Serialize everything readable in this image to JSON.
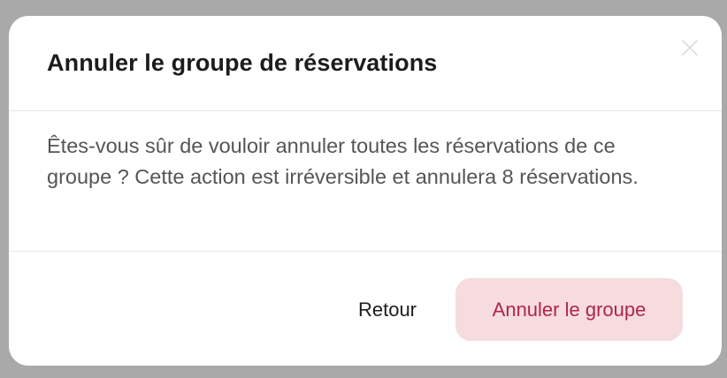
{
  "dialog": {
    "title": "Annuler le groupe de réservations",
    "message": "Êtes-vous sûr de vouloir annuler toutes les réservations de ce groupe ? Cette action est irréversible et annulera 8 réservations.",
    "close_icon": "close-icon",
    "back_label": "Retour",
    "confirm_label": "Annuler le groupe"
  },
  "colors": {
    "backdrop": "#a9a9a9",
    "confirm_background": "#f6dcdf",
    "confirm_text": "#b0254a"
  }
}
